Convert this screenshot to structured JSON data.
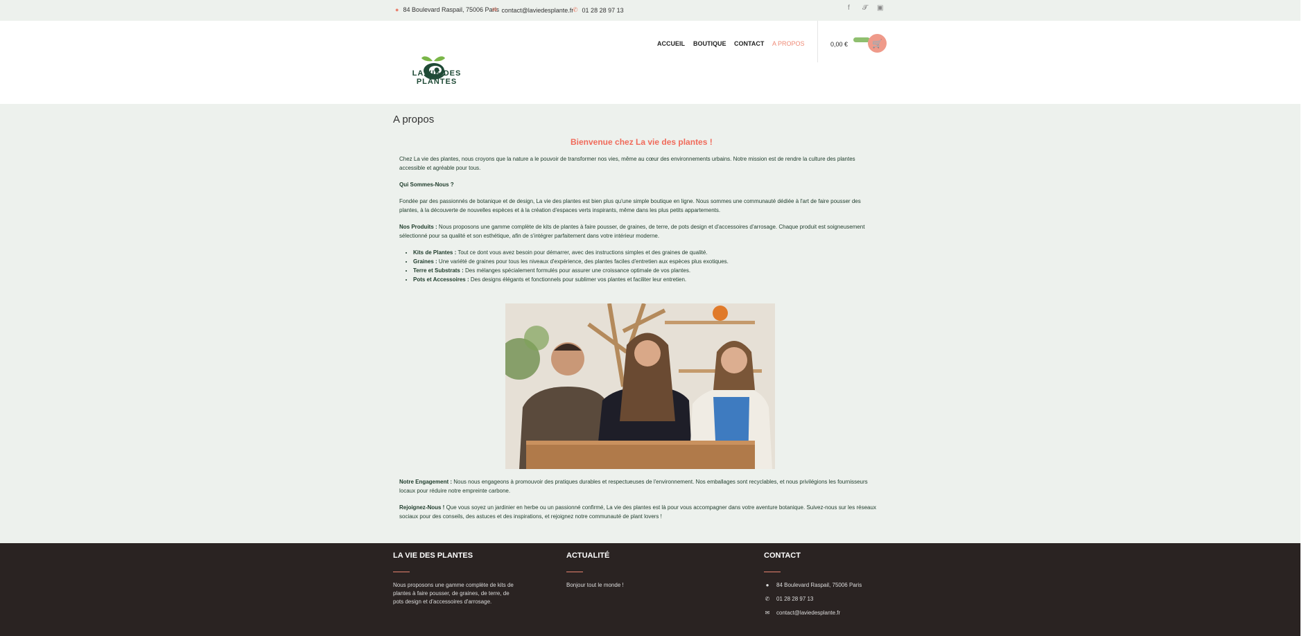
{
  "topbar": {
    "address": "84 Boulevard Raspail, 75006 Paris",
    "email": "contact@laviedesplante.fr",
    "phone": "01 28 28 97 13",
    "social": [
      "facebook-icon",
      "twitter-icon",
      "instagram-icon"
    ]
  },
  "header": {
    "logo_line1": "LA VIE DES",
    "logo_line2": "PLANTES",
    "nav": [
      "ACCUEIL",
      "BOUTIQUE",
      "CONTACT",
      "A PROPOS"
    ],
    "cart_amount": "0,00 €"
  },
  "main": {
    "page_title": "A propos",
    "welcome": "Bienvenue chez La vie des plantes !",
    "intro": "Chez La vie des plantes, nous croyons que la nature a le pouvoir de transformer nos vies, même au cœur des environnements urbains. Notre mission est de rendre la culture des plantes accessible et agréable pour tous.",
    "who_heading": "Qui Sommes-Nous ?",
    "who_text": "Fondée par des passionnés de botanique et de design, La vie des plantes est bien plus qu'une simple boutique en ligne. Nous sommes une communauté dédiée à l'art de faire pousser des plantes, à la découverte de nouvelles espèces et à la création d'espaces verts inspirants, même dans les plus petits appartements.",
    "products_label": "Nos Produits :",
    "products_text": " Nous proposons une gamme complète de kits de plantes à faire pousser, de graines, de terre, de pots design et d'accessoires d'arrosage. Chaque produit est soigneusement sélectionné pour sa qualité et son esthétique, afin de s'intégrer parfaitement dans votre intérieur moderne.",
    "bullets": [
      {
        "label": "Kits de Plantes :",
        "text": " Tout ce dont vous avez besoin pour démarrer, avec des instructions simples et des graines de qualité."
      },
      {
        "label": "Graines :",
        "text": " Une variété de graines pour tous les niveaux d'expérience, des plantes faciles d'entretien aux espèces plus exotiques."
      },
      {
        "label": "Terre et Substrats :",
        "text": " Des mélanges spécialement formulés pour assurer une croissance optimale de vos plantes."
      },
      {
        "label": "Pots et Accessoires :",
        "text": " Des designs élégants et fonctionnels pour sublimer vos plantes et faciliter leur entretien."
      }
    ],
    "engagement_label": "Notre Engagement :",
    "engagement_text": " Nous nous engageons à promouvoir des pratiques durables et respectueuses de l'environnement. Nos emballages sont recyclables, et nous privilégions les fournisseurs locaux pour réduire notre empreinte carbone.",
    "join_label": "Rejoignez-Nous !",
    "join_text": " Que vous soyez un jardinier en herbe ou un passionné confirmé, La vie des plantes est là pour vous accompagner dans votre aventure botanique. Suivez-nous sur les réseaux sociaux pour des conseils, des astuces et des inspirations, et rejoignez notre communauté de plant lovers !"
  },
  "footer": {
    "col1_title": "LA VIE DES PLANTES",
    "col1_text": "Nous proposons une gamme complète de kits de plantes à faire pousser, de graines, de terre, de pots design et d'accessoires d'arrosage.",
    "col2_title": "ACTUALITÉ",
    "col2_text": "Bonjour tout le monde !",
    "col3_title": "CONTACT",
    "address": "84 Boulevard Raspail, 75006 Paris",
    "phone": "01 28 28 97 13",
    "email": "contact@laviedesplante.fr"
  }
}
